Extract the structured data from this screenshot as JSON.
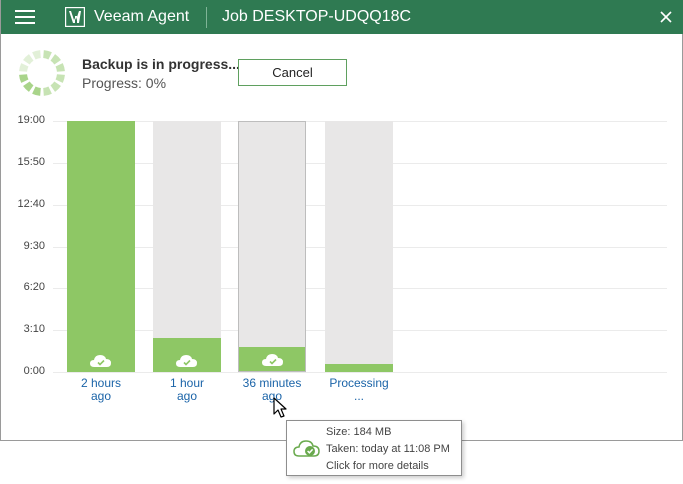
{
  "titlebar": {
    "app_name": "Veeam Agent",
    "job_title": "Job DESKTOP-UDQQ18C"
  },
  "status": {
    "title": "Backup is in progress...",
    "progress_text": "Progress: 0%",
    "cancel_label": "Cancel"
  },
  "chart_data": {
    "type": "bar",
    "ylabel": "",
    "xlabel": "",
    "y_ticks": [
      "19:00",
      "15:50",
      "12:40",
      "9:30",
      "6:20",
      "3:10",
      "0:00"
    ],
    "ylim": [
      0,
      1140
    ],
    "categories": [
      "2 hours ago",
      "1 hour ago",
      "36 minutes ago",
      "Processing ..."
    ],
    "category_lines": [
      [
        "2 hours",
        "ago"
      ],
      [
        "1 hour",
        "ago"
      ],
      [
        "36 minutes",
        "ago"
      ],
      [
        "Processing",
        "..."
      ]
    ],
    "values": [
      1140,
      155,
      110,
      35
    ],
    "completed": [
      true,
      true,
      true,
      false
    ],
    "selected_index": 2,
    "grid": true
  },
  "tooltip": {
    "size": "Size: 184 MB",
    "taken": "Taken: today at 11:08 PM",
    "details": "Click for more details"
  },
  "colors": {
    "titlebar": "#2f7a52",
    "bar_fill": "#8ec765",
    "bar_background": "#e8e7e7",
    "link": "#1b64a8"
  },
  "icons": {
    "menu": "hamburger-icon",
    "logo": "veeam-logo-icon",
    "close": "close-icon",
    "spinner": "progress-spinner-icon",
    "backup_point": "cloud-check-icon"
  }
}
